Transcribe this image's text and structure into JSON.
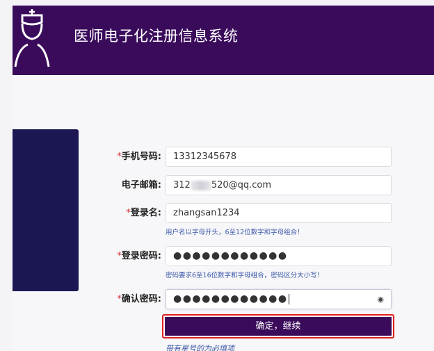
{
  "header": {
    "title": "医师电子化注册信息系统",
    "logo_icon": "nurse-icon",
    "background": "#3a0b5b"
  },
  "form": {
    "phone": {
      "label": "手机号码:",
      "required": "*",
      "value": "13312345678"
    },
    "email": {
      "label": "电子邮箱:",
      "value_prefix": "312",
      "value_suffix": "520@qq.com"
    },
    "username": {
      "label": "登录名:",
      "required": "*",
      "value": "zhangsan1234",
      "hint": "用户名以字母开头，6至12位数字和字母组合！"
    },
    "password": {
      "label": "登录密码:",
      "required": "*",
      "value": "●●●●●●●●●●●●",
      "hint": "密码要求6至16位数字和字母组合，密码区分大小写！"
    },
    "confirm_password": {
      "label": "确认密码:",
      "required": "*",
      "value": "●●●●●●●●●●●●",
      "toggle_icon": "eye-icon",
      "toggle_glyph": "◉"
    },
    "submit_label": "确定，继续",
    "required_note": "带有星号的为必填项"
  },
  "colors": {
    "brand": "#3a0b5b",
    "sidebar": "#1b1753",
    "required_star": "#d23030",
    "hint": "#3a56a8",
    "highlight": "#e01f1f"
  }
}
